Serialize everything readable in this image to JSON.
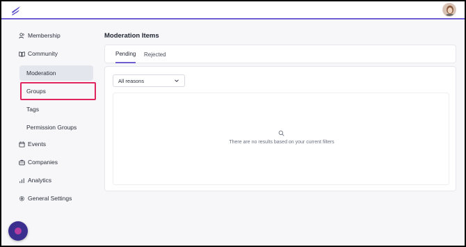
{
  "sidebar": {
    "items": [
      {
        "label": "Membership",
        "icon": "users-icon"
      },
      {
        "label": "Community",
        "icon": "book-open-icon"
      },
      {
        "label": "Events",
        "icon": "calendar-icon"
      },
      {
        "label": "Companies",
        "icon": "briefcase-icon"
      },
      {
        "label": "Analytics",
        "icon": "bar-chart-icon"
      },
      {
        "label": "General Settings",
        "icon": "gear-icon"
      }
    ],
    "community_subitems": [
      {
        "label": "Moderation",
        "active": true
      },
      {
        "label": "Groups",
        "active": false
      },
      {
        "label": "Tags",
        "active": false
      },
      {
        "label": "Permission Groups",
        "active": false
      }
    ]
  },
  "main": {
    "title": "Moderation Items",
    "tabs": [
      {
        "label": "Pending",
        "active": true
      },
      {
        "label": "Rejected",
        "active": false
      }
    ],
    "filter": {
      "selected": "All reasons"
    },
    "empty_state": {
      "icon": "search-icon",
      "message": "There are no results based on your current filters"
    }
  },
  "colors": {
    "accent": "#6d5fd3",
    "highlight": "#e0245e",
    "active_bg": "#e4e6ee",
    "fab": "#3a2f8f"
  }
}
